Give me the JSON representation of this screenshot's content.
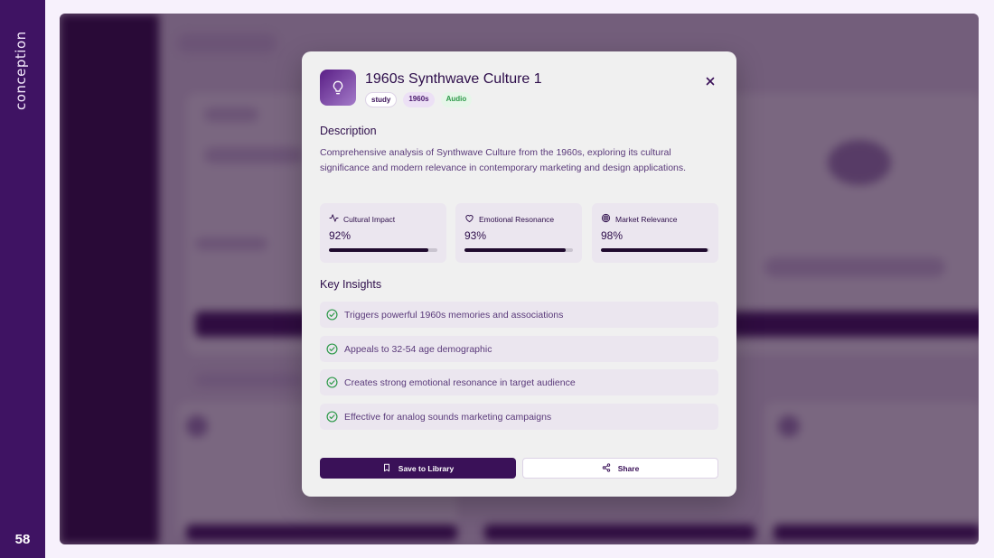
{
  "slide": {
    "section_label": "conception",
    "page_number": "58"
  },
  "modal": {
    "title": "1960s Synthwave Culture 1",
    "icon": "lightbulb-icon",
    "tags": [
      "study",
      "1960s",
      "Audio"
    ],
    "description_heading": "Description",
    "description": "Comprehensive analysis of Synthwave Culture from the 1960s, exploring its cultural significance and modern relevance in contemporary marketing and design applications.",
    "metrics": [
      {
        "label": "Cultural Impact",
        "value": "92%",
        "fraction": 0.92,
        "icon": "activity-icon"
      },
      {
        "label": "Emotional Resonance",
        "value": "93%",
        "fraction": 0.93,
        "icon": "heart-icon"
      },
      {
        "label": "Market Relevance",
        "value": "98%",
        "fraction": 0.98,
        "icon": "target-icon"
      }
    ],
    "insights_heading": "Key Insights",
    "insights": [
      "Triggers powerful 1960s memories and associations",
      "Appeals to 32-54 age demographic",
      "Creates strong emotional resonance in target audience",
      "Effective for analog sounds marketing campaigns"
    ],
    "buttons": {
      "save": "Save to Library",
      "share": "Share"
    }
  },
  "colors": {
    "brand_purple": "#3f1363",
    "success_green": "#2e9a4a"
  }
}
